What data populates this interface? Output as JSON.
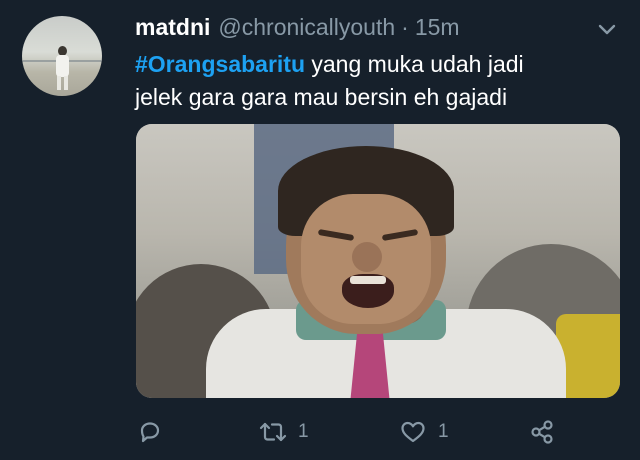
{
  "tweet": {
    "display_name": "matdni",
    "handle": "@chronicallyouth",
    "separator": "·",
    "time": "15m",
    "hashtag": "#Orangsabaritu",
    "text_line1": " yang muka udah jadi",
    "text_line2": "jelek gara gara mau bersin eh gajadi"
  },
  "actions": {
    "retweet_count": "1",
    "like_count": "1"
  },
  "icons": {
    "menu": "chevron-down-icon",
    "reply": "reply-icon",
    "retweet": "retweet-icon",
    "like": "heart-icon",
    "share": "share-icon"
  },
  "colors": {
    "background": "#16202b",
    "hashtag": "#1da1f2",
    "secondary_text": "#8899a6"
  }
}
